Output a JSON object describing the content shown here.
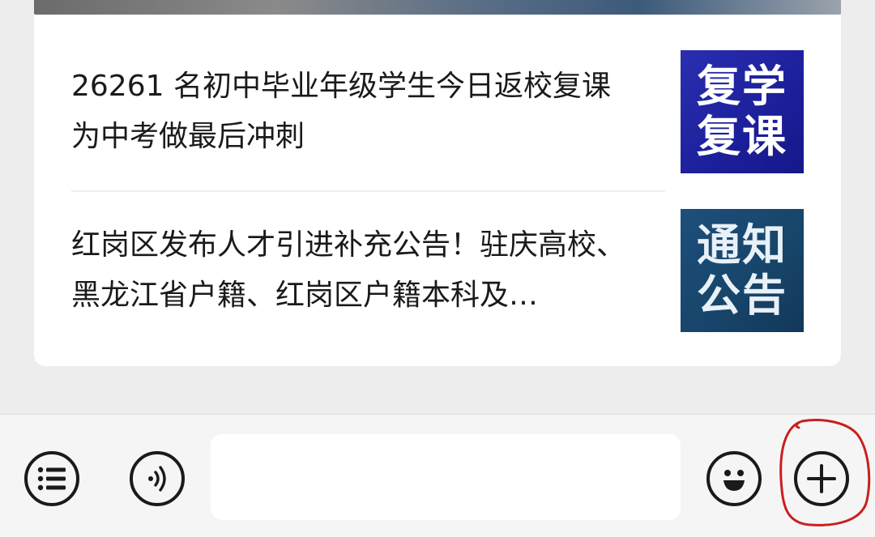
{
  "articles": [
    {
      "title": "26261 名初中毕业年级学生今日返校复课 为中考做最后冲刺",
      "thumbnail_text": [
        "复学",
        "复课"
      ]
    },
    {
      "title": "红岗区发布人才引进补充公告！驻庆高校、黑龙江省户籍、红岗区户籍本科及…",
      "thumbnail_text": [
        "通知",
        "公告"
      ]
    }
  ],
  "input_bar": {
    "input_value": "",
    "icons": [
      "menu-icon",
      "voice-icon",
      "emoji-icon",
      "plus-icon"
    ]
  },
  "colors": {
    "background": "#ededed",
    "card": "#ffffff",
    "thumbnail_1": "#2a2fb0",
    "thumbnail_2": "#1d4f7c",
    "annotation": "#c8201e"
  }
}
